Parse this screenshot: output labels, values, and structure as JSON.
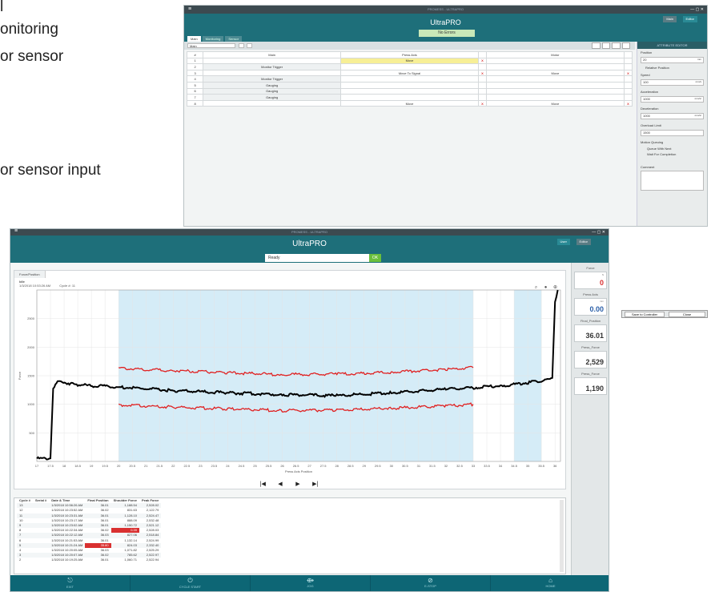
{
  "page_text": {
    "line1": "l",
    "line2": "onitoring",
    "line3": "or sensor",
    "line4": "or sensor input"
  },
  "back_window": {
    "titlebar_text": "PROMESS - ULTRAPRO",
    "title": "UltraPRO",
    "status": "No Errors",
    "tabs": [
      "Main",
      "Monitoring",
      "Sensor"
    ],
    "header_tabs": [
      "Main",
      "Editor"
    ],
    "selector_value": "Main",
    "right_panel": {
      "heading": "ATTRIBUTE EDITOR",
      "position_label": "Position",
      "position_value": "20",
      "position_unit": "mm",
      "relative_label": "Relative Position",
      "speed_label": "Speed",
      "speed_value": "100",
      "speed_unit": "mm/s",
      "accel_label": "Acceleration",
      "accel_value": "1000",
      "accel_unit": "mm/s²",
      "decel_label": "Deceleration",
      "decel_value": "1000",
      "decel_unit": "mm/s²",
      "overload_label": "Overload Limit",
      "overload_value": "1500",
      "queue_label": "Motion Queuing",
      "queue_opt1": "Queue With Next",
      "queue_opt2": "Wait For Completion",
      "comment_label": "Comment"
    },
    "table_headers": [
      "#",
      "Main",
      "Press Axis",
      "",
      "Motor",
      ""
    ],
    "rows": [
      [
        "1",
        "",
        "Move",
        "X",
        "",
        ""
      ],
      [
        "2",
        "Monitor Trigger",
        "",
        "",
        "",
        ""
      ],
      [
        "3",
        "",
        "Move To Signal",
        "X",
        "Move",
        "X"
      ],
      [
        "4",
        "Monitor Trigger",
        "",
        "",
        "",
        ""
      ],
      [
        "5",
        "Gauging",
        "",
        "",
        "",
        ""
      ],
      [
        "6",
        "Gauging",
        "",
        "",
        "",
        ""
      ],
      [
        "7",
        "Gauging",
        "",
        "",
        "",
        ""
      ],
      [
        "8",
        "",
        "Move",
        "X",
        "Move",
        "X"
      ]
    ],
    "floating": {
      "save": "Save to Controller",
      "close": "Close"
    }
  },
  "front_window": {
    "titlebar_text": "PROMESS - ULTRAPRO",
    "title": "UltraPRO",
    "status": "Ready",
    "ok": "OK",
    "header_tabs": [
      "User",
      "Editor"
    ],
    "chart_tab": "Force/Position",
    "chart_info": {
      "line1": "Idle",
      "timestamp": "1/3/2018 10:53:26 AM",
      "cycle": "Cycle #: 11"
    },
    "side_panel": [
      {
        "label": "Force",
        "unit": "N",
        "value": "0",
        "color": "#d93030"
      },
      {
        "label": "Press Axis",
        "unit": "mm",
        "value": "0.00",
        "color": "#2a5fa8"
      },
      {
        "label": "Final_Position",
        "unit": "",
        "value": "36.01",
        "color": "#333333"
      },
      {
        "label": "Press_Force",
        "unit": "",
        "value": "2,529",
        "color": "#333333"
      },
      {
        "label": "Press_Force",
        "unit": "",
        "value": "1,190",
        "color": "#333333"
      }
    ],
    "grid_headers": [
      "Cycle #",
      "Serial #",
      "Date & Time",
      "Final Position",
      "Shoulder Force",
      "Peak Force"
    ],
    "grid_rows": [
      [
        "13",
        "",
        "1/3/2018 10:56:26 AM",
        "36.01",
        "1,188.54",
        "2,528.02"
      ],
      [
        "12",
        "",
        "1/3/2018 10:23:52 AM",
        "36.02",
        "831.63",
        "2,122.79"
      ],
      [
        "11",
        "",
        "1/3/2018 10:23:31 AM",
        "36.01",
        "1,128.10",
        "2,524.47"
      ],
      [
        "10",
        "",
        "1/3/2018 10:23:17 AM",
        "36.01",
        "888.09",
        "2,532.48"
      ],
      [
        "9",
        "",
        "1/3/2018 10:23:02 AM",
        "36.01",
        "1,150.72",
        "2,521.12"
      ],
      [
        "8",
        "",
        "1/3/2018 10:22:34 AM",
        "36.02",
        "0.39",
        "2,528.03"
      ],
      [
        "7",
        "",
        "1/3/2018 10:22:12 AM",
        "36.03",
        "827.06",
        "2,518.84"
      ],
      [
        "6",
        "",
        "1/3/2018 10:21:53 AM",
        "36.01",
        "1,132.14",
        "2,524.99"
      ],
      [
        "5",
        "",
        "1/3/2018 10:21:24 AM",
        "35.80",
        "824.03",
        "2,332.40"
      ],
      [
        "4",
        "",
        "1/3/2018 10:20:05 AM",
        "36.03",
        "1,071.82",
        "2,525.29"
      ],
      [
        "3",
        "",
        "1/3/2018 10:20:07 AM",
        "36.02",
        "785.62",
        "2,522.97"
      ],
      [
        "2",
        "",
        "1/3/2018 10:19:25 AM",
        "36.01",
        "1,060.71",
        "2,522.94"
      ]
    ],
    "bottom_buttons": [
      {
        "label": "EXIT",
        "icon": "exit-icon",
        "glyph": "⎋"
      },
      {
        "label": "CYCLE START",
        "icon": "power-icon",
        "glyph": "⏻"
      },
      {
        "label": "JOG",
        "icon": "jog-icon",
        "glyph": "⟴"
      },
      {
        "label": "E-STOP",
        "icon": "stop-icon",
        "glyph": "⊘"
      },
      {
        "label": "HOME",
        "icon": "home-icon",
        "glyph": "⌂"
      }
    ],
    "playback": [
      "|◀",
      "◀",
      "▶",
      "▶|"
    ]
  },
  "chart_data": {
    "type": "line",
    "xlabel": "Press Axis Position",
    "ylabel": "Force",
    "xlim": [
      17,
      36.2
    ],
    "ylim": [
      0,
      3000
    ],
    "yticks": [
      500,
      1000,
      1500,
      2000,
      2500
    ],
    "xticks": [
      "17",
      "17.5",
      "18",
      "18.5",
      "19",
      "19.5",
      "20",
      "20.5",
      "21",
      "21.5",
      "22",
      "22.5",
      "23",
      "23.5",
      "24",
      "24.5",
      "25",
      "25.5",
      "26",
      "26.5",
      "27",
      "27.5",
      "28",
      "28.5",
      "29",
      "29.5",
      "30",
      "30.5",
      "31",
      "31.5",
      "32",
      "32.5",
      "33",
      "33.5",
      "34",
      "34.5",
      "35",
      "35.5",
      "36"
    ],
    "bands": [
      [
        20,
        33
      ],
      [
        34.5,
        35.5
      ]
    ],
    "series": [
      {
        "color": "#000000",
        "x": [
          17,
          17.5,
          17.6,
          17.8,
          18.5,
          20,
          22,
          24,
          26,
          28,
          30,
          32,
          34,
          35.5,
          35.9,
          36.0,
          36.1
        ],
        "y": [
          50,
          50,
          1300,
          1400,
          1340,
          1300,
          1240,
          1200,
          1170,
          1150,
          1200,
          1260,
          1320,
          1410,
          1450,
          2800,
          3000
        ]
      },
      {
        "color": "#e02020",
        "x": [
          20,
          22,
          24,
          26,
          28,
          30,
          32,
          33
        ],
        "y": [
          1630,
          1590,
          1550,
          1520,
          1530,
          1560,
          1610,
          1640
        ]
      },
      {
        "color": "#e02020",
        "x": [
          20,
          22,
          24,
          26,
          28,
          30,
          32,
          33
        ],
        "y": [
          990,
          950,
          920,
          890,
          900,
          930,
          970,
          1000
        ]
      }
    ]
  }
}
